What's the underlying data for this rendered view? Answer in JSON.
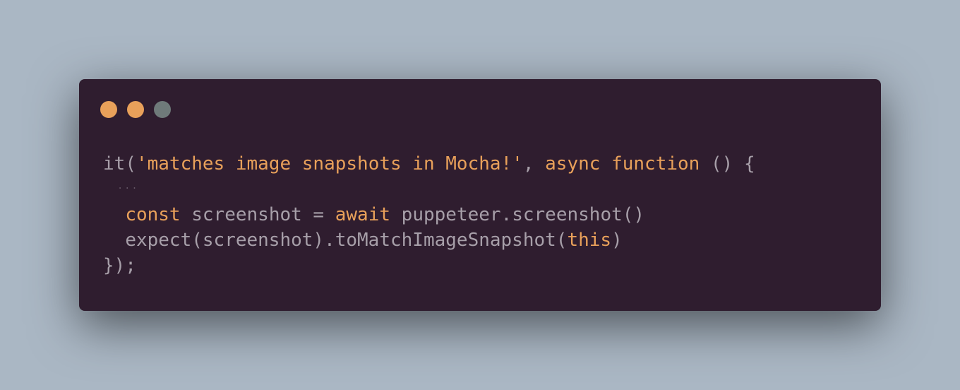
{
  "window_controls": [
    {
      "name": "close",
      "color": "#e8a05a"
    },
    {
      "name": "minimize",
      "color": "#e8a05a"
    },
    {
      "name": "maximize",
      "color": "#6f7a7a"
    }
  ],
  "colors": {
    "page_background": "#aab7c4",
    "window_background": "#2f1d2f",
    "text": "#a79fa9",
    "keyword": "#e8a05a",
    "string": "#e8a05a",
    "comment": "#6a5c6b"
  },
  "code": {
    "line1": {
      "fn": "it",
      "open": "(",
      "string": "'matches image snapshots in Mocha!'",
      "comma": ", ",
      "kw_async": "async",
      "sp1": " ",
      "kw_function": "function",
      "rest": " () {"
    },
    "line2": {
      "indent": "  ",
      "ellipsis": "..."
    },
    "line3": {
      "indent": "  ",
      "kw_const": "const",
      "mid": " screenshot = ",
      "kw_await": "await",
      "rest": " puppeteer.screenshot()"
    },
    "line4": {
      "indent": "  ",
      "text": "expect(screenshot).toMatchImageSnapshot(",
      "kw_this": "this",
      "close": ")"
    },
    "line5": {
      "text": "});"
    }
  }
}
